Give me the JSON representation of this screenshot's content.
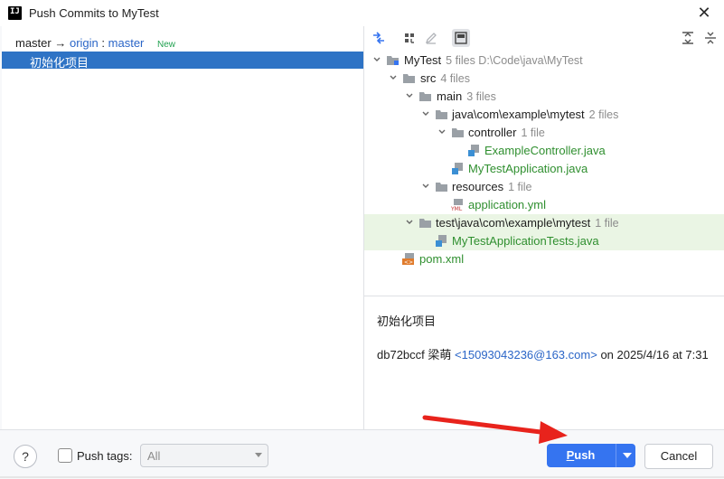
{
  "window": {
    "title": "Push Commits to MyTest",
    "app_icon_glyph": "IJ"
  },
  "left": {
    "branch": {
      "local": "master",
      "arrow": "→",
      "remote": "origin",
      "sep": ":",
      "remote_branch": "master",
      "badge": "New"
    },
    "commits": [
      {
        "message": "初始化项目"
      }
    ]
  },
  "toolbar": {
    "icons": [
      "compare-icon",
      "group-by-icon",
      "edit-icon",
      "preview-icon",
      "expand-all-icon",
      "collapse-all-icon"
    ]
  },
  "tree": [
    {
      "name": "MyTest",
      "meta": "5 files  D:\\Code\\java\\MyTest"
    },
    {
      "name": "src",
      "meta": "4 files"
    },
    {
      "name": "main",
      "meta": "3 files"
    },
    {
      "name": "java\\com\\example\\mytest",
      "meta": "2 files"
    },
    {
      "name": "controller",
      "meta": "1 file"
    },
    {
      "name": "ExampleController.java",
      "meta": ""
    },
    {
      "name": "MyTestApplication.java",
      "meta": ""
    },
    {
      "name": "resources",
      "meta": "1 file"
    },
    {
      "name": "application.yml",
      "meta": ""
    },
    {
      "name": "test\\java\\com\\example\\mytest",
      "meta": "1 file"
    },
    {
      "name": "MyTestApplicationTests.java",
      "meta": ""
    },
    {
      "name": "pom.xml",
      "meta": ""
    }
  ],
  "details": {
    "title": "初始化项目",
    "hash": "db72bccf",
    "author": "梁萌",
    "email": "<15093043236@163.com>",
    "date_text": "on 2025/4/16 at 7:31"
  },
  "bottom": {
    "help": "?",
    "push_tags_label": "Push tags:",
    "push_tags_value": "All",
    "push_label_first": "P",
    "push_label_rest": "ush",
    "cancel_label": "Cancel"
  },
  "colors": {
    "accent": "#3574f0",
    "selection": "#2e73c5",
    "new_file": "#2f8f2f",
    "annotation_arrow": "#e8231c"
  }
}
